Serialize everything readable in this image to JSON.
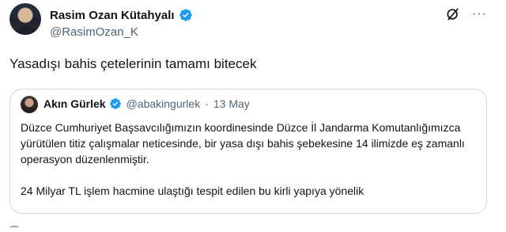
{
  "retweet_banner": "",
  "author": {
    "name": "Rasim Ozan Kütahyalı",
    "handle": "@RasimOzan_K",
    "verified_icon": "verified-badge-icon"
  },
  "actions": {
    "grok_icon": "grok-icon",
    "more_label": "···"
  },
  "tweet": {
    "text": "Yasadışı bahis çetelerinin tamamı bitecek"
  },
  "quote": {
    "name": "Akın Gürlek",
    "handle": "@abakingurlek",
    "separator": "·",
    "date": "13 May",
    "paragraph1": "Düzce Cumhuriyet Başsavcılığımızın koordinesinde Düzce İl Jandarma Komutanlığımızca yürütülen titiz çalışmalar neticesinde, bir yasa dışı bahis şebekesine 14 ilimizde eş zamanlı operasyon düzenlenmiştir.",
    "paragraph2": "24 Milyar TL işlem hacmine ulaştığı tespit edilen bu kirli yapıya yönelik"
  },
  "colors": {
    "verified": "#1d9bf0",
    "text_primary": "#0f1419",
    "text_secondary": "#536471",
    "border": "#cfd9de"
  }
}
